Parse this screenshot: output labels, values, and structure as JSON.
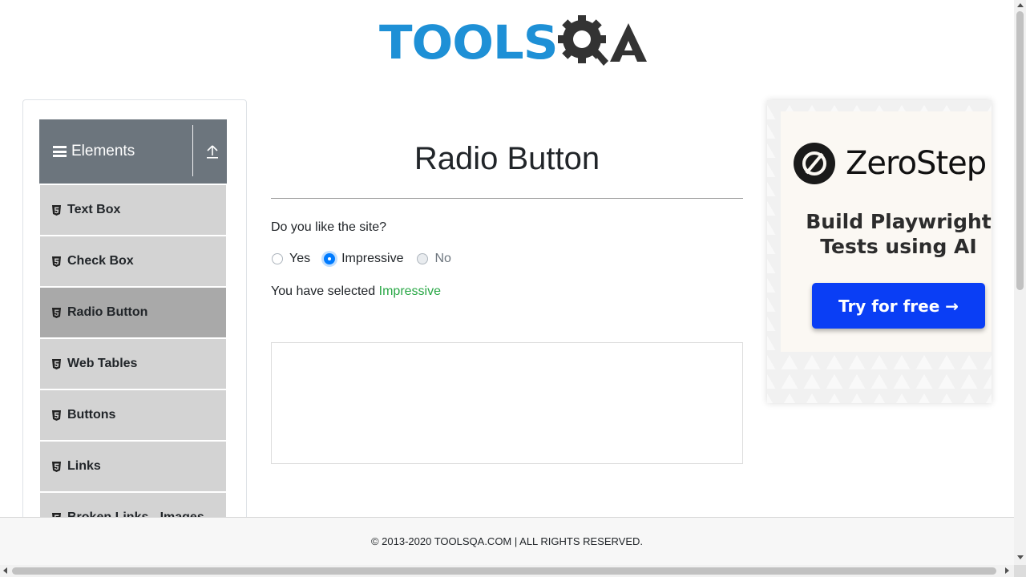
{
  "header": {
    "logo_text": "TOOLSQA"
  },
  "sidebar": {
    "group_title": "Elements",
    "items": [
      {
        "label": "Text Box"
      },
      {
        "label": "Check Box"
      },
      {
        "label": "Radio Button",
        "active": true
      },
      {
        "label": "Web Tables"
      },
      {
        "label": "Buttons"
      },
      {
        "label": "Links"
      },
      {
        "label": "Broken Links - Images"
      }
    ]
  },
  "main": {
    "title": "Radio Button",
    "question": "Do you like the site?",
    "options": [
      {
        "label": "Yes",
        "checked": false,
        "disabled": false
      },
      {
        "label": "Impressive",
        "checked": true,
        "disabled": false
      },
      {
        "label": "No",
        "checked": false,
        "disabled": true
      }
    ],
    "result_prefix": "You have selected",
    "result_value": "Impressive"
  },
  "ad": {
    "brand": "ZeroStep",
    "headline_line1": "Build Playwright",
    "headline_line2": "Tests using AI",
    "cta": "Try for free →"
  },
  "footer": {
    "text": "© 2013-2020 TOOLSQA.COM | ALL RIGHTS RESERVED."
  },
  "colors": {
    "brand_blue": "#1e90d6",
    "sidebar_header": "#6c757d",
    "result_green": "#28a745",
    "radio_blue": "#007bff",
    "cta_blue": "#0a3ef5"
  }
}
